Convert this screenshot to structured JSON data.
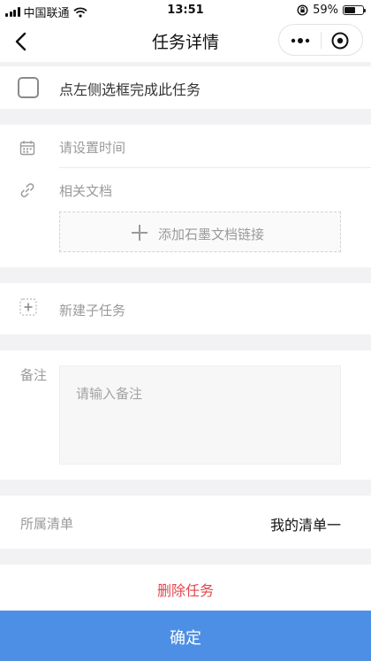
{
  "status_bar": {
    "carrier": "中国联通",
    "time": "13:51",
    "battery_percent": "59%",
    "battery_level": 0.59
  },
  "nav": {
    "title": "任务详情"
  },
  "task": {
    "complete_hint": "点左侧选框完成此任务"
  },
  "details": {
    "time_placeholder": "请设置时间",
    "docs_label": "相关文档",
    "add_doc_link": "添加石墨文档链接"
  },
  "subtask": {
    "new_label": "新建子任务"
  },
  "notes": {
    "label": "备注",
    "placeholder": "请输入备注"
  },
  "list": {
    "label": "所属清单",
    "value": "我的清单一"
  },
  "actions": {
    "delete_label": "删除任务",
    "confirm_label": "确定"
  },
  "colors": {
    "accent": "#4d8fe4",
    "danger": "#e0474c",
    "placeholder": "#9a9a9a",
    "background": "#f2f2f4"
  }
}
